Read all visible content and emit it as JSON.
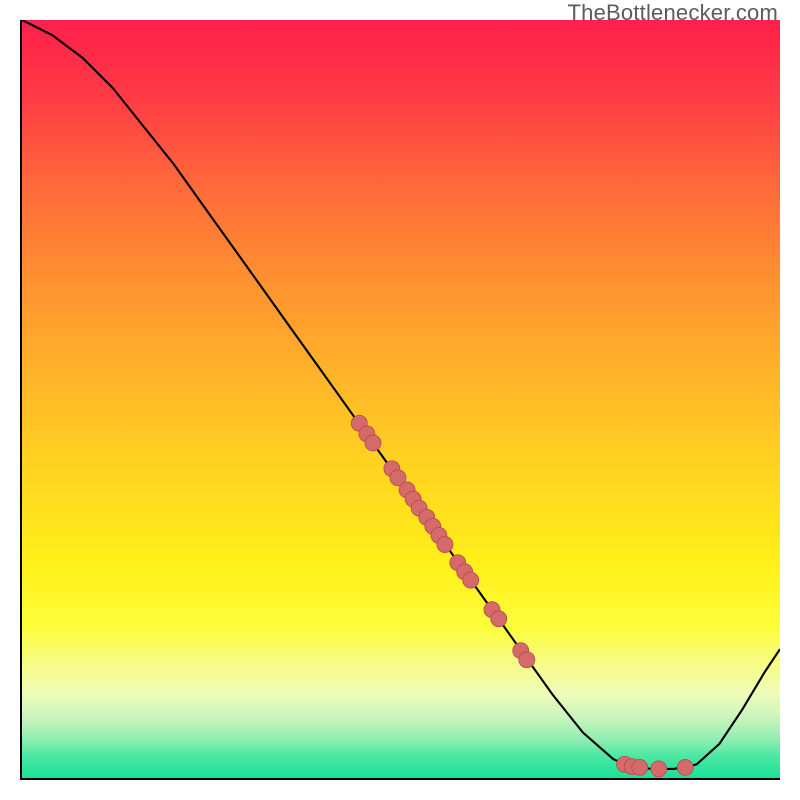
{
  "watermark": "TheBottlenecker.com",
  "colors": {
    "point_fill": "#d46a6a",
    "point_stroke": "#b94e4e",
    "curve": "#000000"
  },
  "chart_data": {
    "type": "line",
    "title": "",
    "xlabel": "",
    "ylabel": "",
    "xlim": [
      0,
      100
    ],
    "ylim": [
      0,
      100
    ],
    "note": "y is plotted downward from top; values below are in that top-down coordinate so higher number = lower on screen.",
    "curve": [
      {
        "x": 0,
        "y": 0
      },
      {
        "x": 4,
        "y": 2
      },
      {
        "x": 8,
        "y": 5
      },
      {
        "x": 12,
        "y": 9
      },
      {
        "x": 16,
        "y": 14
      },
      {
        "x": 20,
        "y": 19
      },
      {
        "x": 25,
        "y": 26
      },
      {
        "x": 30,
        "y": 33
      },
      {
        "x": 35,
        "y": 40
      },
      {
        "x": 40,
        "y": 47
      },
      {
        "x": 45,
        "y": 54
      },
      {
        "x": 50,
        "y": 61
      },
      {
        "x": 55,
        "y": 68
      },
      {
        "x": 60,
        "y": 75
      },
      {
        "x": 65,
        "y": 82
      },
      {
        "x": 70,
        "y": 89
      },
      {
        "x": 74,
        "y": 94
      },
      {
        "x": 78,
        "y": 97.5
      },
      {
        "x": 80,
        "y": 98.4
      },
      {
        "x": 83,
        "y": 98.8
      },
      {
        "x": 86,
        "y": 98.8
      },
      {
        "x": 89,
        "y": 98.2
      },
      {
        "x": 92,
        "y": 95.5
      },
      {
        "x": 95,
        "y": 91
      },
      {
        "x": 98,
        "y": 86
      },
      {
        "x": 100,
        "y": 83
      }
    ],
    "points": [
      {
        "x": 44.5,
        "y": 53.2
      },
      {
        "x": 45.5,
        "y": 54.6
      },
      {
        "x": 46.3,
        "y": 55.8
      },
      {
        "x": 48.8,
        "y": 59.2
      },
      {
        "x": 49.6,
        "y": 60.4
      },
      {
        "x": 50.8,
        "y": 62.0
      },
      {
        "x": 51.6,
        "y": 63.2
      },
      {
        "x": 52.4,
        "y": 64.4
      },
      {
        "x": 53.4,
        "y": 65.6
      },
      {
        "x": 54.2,
        "y": 66.8
      },
      {
        "x": 55.0,
        "y": 68.0
      },
      {
        "x": 55.8,
        "y": 69.2
      },
      {
        "x": 57.5,
        "y": 71.6
      },
      {
        "x": 58.4,
        "y": 72.8
      },
      {
        "x": 59.2,
        "y": 73.9
      },
      {
        "x": 62.0,
        "y": 77.8
      },
      {
        "x": 62.9,
        "y": 79.0
      },
      {
        "x": 65.8,
        "y": 83.2
      },
      {
        "x": 66.6,
        "y": 84.4
      },
      {
        "x": 79.5,
        "y": 98.2
      },
      {
        "x": 80.5,
        "y": 98.5
      },
      {
        "x": 81.5,
        "y": 98.6
      },
      {
        "x": 84.0,
        "y": 98.8
      },
      {
        "x": 87.5,
        "y": 98.6
      }
    ]
  }
}
